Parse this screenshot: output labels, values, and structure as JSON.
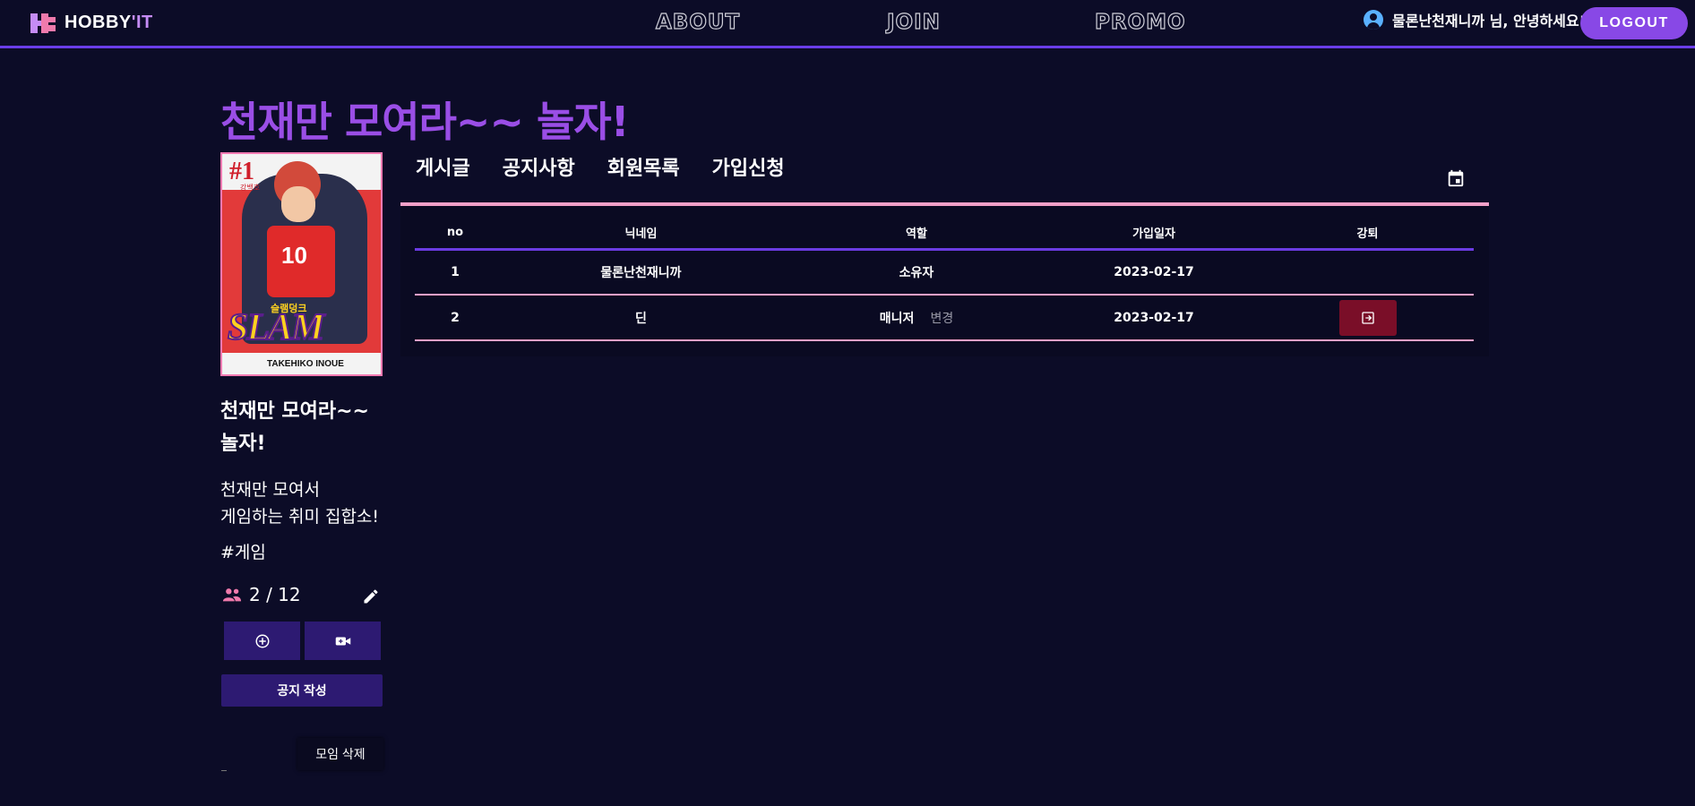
{
  "header": {
    "logo_text_main": "HOBBY",
    "logo_text_accent": "'IT",
    "nav": [
      {
        "label": "ABOUT"
      },
      {
        "label": "JOIN"
      },
      {
        "label": "PROMO"
      }
    ],
    "greeting": "물론난천재니까 님, 안녕하세요!",
    "logout_label": "LOGOUT"
  },
  "page": {
    "title": "천재만 모여라~~ 놀자!"
  },
  "sidebar": {
    "cover": {
      "number": "#1",
      "subtitle": "강백호",
      "jersey_text": "10",
      "title_korean": "슬램덩크",
      "title": "SLAM DUNK",
      "author": "TAKEHIKO INOUE"
    },
    "group_name": "천재만 모여라~~ 놀자!",
    "description_line1": "천재만 모여서",
    "description_line2": "게임하는 취미 집합소!",
    "tag": "#게임",
    "member_count": "2 / 12",
    "notice_button": "공지 작성",
    "delete_button": "모임 삭제"
  },
  "tabs": [
    {
      "label": "게시글"
    },
    {
      "label": "공지사항"
    },
    {
      "label": "회원목록"
    },
    {
      "label": "가입신청"
    }
  ],
  "members_table": {
    "headers": [
      "no",
      "닉네임",
      "역할",
      "가입일자",
      "강퇴"
    ],
    "rows": [
      {
        "no": "1",
        "nickname": "물론난천재니까",
        "role": "소유자",
        "joined": "2023-02-17"
      },
      {
        "no": "2",
        "nickname": "딘",
        "role": "매니저",
        "change": "변경",
        "joined": "2023-02-17"
      }
    ]
  },
  "colors": {
    "background": "#0c0c27",
    "accent_purple": "#8848e6",
    "title_purple": "#9a4ee6",
    "pink": "#f4a0c8",
    "kick_red": "#7a0e28",
    "button_dark_purple": "#2d1a72"
  }
}
